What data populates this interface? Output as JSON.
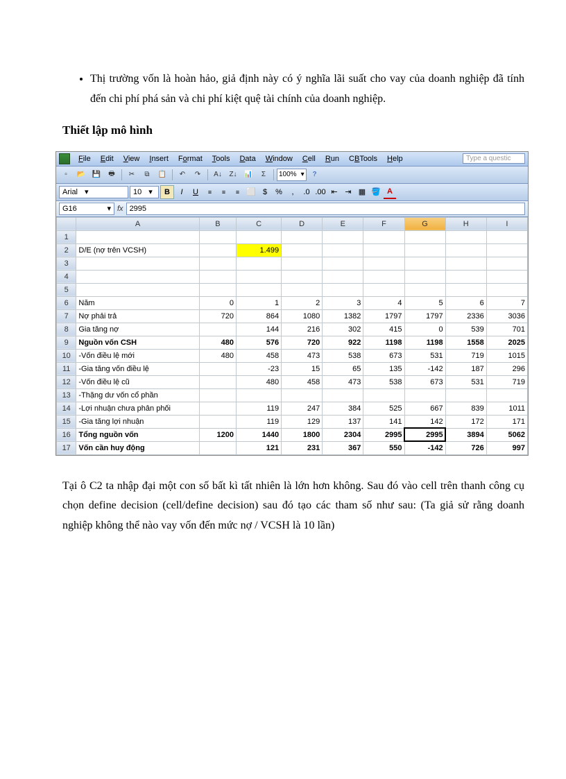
{
  "doc": {
    "bullet1": "Thị trường vốn là hoàn hảo, giả định này có ý nghĩa lãi suất cho vay của doanh nghiệp đã tính đến chi phí phá sản và chi phí kiệt quệ tài chính của doanh nghiệp.",
    "heading": "Thiết lập mô hình",
    "para2": "Tại ô C2 ta nhập đại một con số bất kì tất nhiên là lớn hơn không. Sau đó vào cell trên thanh công cụ chọn define decision (cell/define decision) sau đó tạo các tham số như sau: (Ta giả sử rằng doanh nghiệp không thể nào vay vốn đến mức nợ / VCSH là 10 lần)"
  },
  "excel": {
    "menu": [
      "File",
      "Edit",
      "View",
      "Insert",
      "Format",
      "Tools",
      "Data",
      "Window",
      "Cell",
      "Run",
      "CBTools",
      "Help"
    ],
    "qbox": "Type a questic",
    "zoom": "100%",
    "font": "Arial",
    "fontsize": "10",
    "namebox": "G16",
    "formula": "2995",
    "cols": [
      "A",
      "B",
      "C",
      "D",
      "E",
      "F",
      "G",
      "H",
      "I"
    ],
    "highlight_cell": "1.499",
    "rows": [
      {
        "n": "1",
        "label": "",
        "cells": [
          "",
          "",
          "",
          "",
          "",
          "",
          "",
          ""
        ]
      },
      {
        "n": "2",
        "label": "D/E (nợ trên VCSH)",
        "cells": [
          "",
          "__HL__",
          "",
          "",
          "",
          "",
          "",
          ""
        ]
      },
      {
        "n": "3",
        "label": "",
        "cells": [
          "",
          "",
          "",
          "",
          "",
          "",
          "",
          ""
        ]
      },
      {
        "n": "4",
        "label": "",
        "cells": [
          "",
          "",
          "",
          "",
          "",
          "",
          "",
          ""
        ]
      },
      {
        "n": "5",
        "label": "",
        "cells": [
          "",
          "",
          "",
          "",
          "",
          "",
          "",
          ""
        ]
      },
      {
        "n": "6",
        "label": "Năm",
        "cells": [
          "0",
          "1",
          "2",
          "3",
          "4",
          "5",
          "6",
          "7"
        ]
      },
      {
        "n": "7",
        "label": "Nợ phải trả",
        "cells": [
          "720",
          "864",
          "1080",
          "1382",
          "1797",
          "1797",
          "2336",
          "3036"
        ]
      },
      {
        "n": "8",
        "label": "Gia tăng nợ",
        "cells": [
          "",
          "144",
          "216",
          "302",
          "415",
          "0",
          "539",
          "701"
        ]
      },
      {
        "n": "9",
        "label": "Nguồn vốn CSH",
        "bold": true,
        "cells": [
          "480",
          "576",
          "720",
          "922",
          "1198",
          "1198",
          "1558",
          "2025"
        ]
      },
      {
        "n": "10",
        "label": "   -Vốn điều lệ mới",
        "cells": [
          "480",
          "458",
          "473",
          "538",
          "673",
          "531",
          "719",
          "1015"
        ]
      },
      {
        "n": "11",
        "label": "   -Gia tăng vốn điều lệ",
        "cells": [
          "",
          "-23",
          "15",
          "65",
          "135",
          "-142",
          "187",
          "296"
        ]
      },
      {
        "n": "12",
        "label": "   -Vốn điều lệ cũ",
        "cells": [
          "",
          "480",
          "458",
          "473",
          "538",
          "673",
          "531",
          "719"
        ]
      },
      {
        "n": "13",
        "label": "   -Thặng dư vốn cổ phần",
        "cells": [
          "",
          "",
          "",
          "",
          "",
          "",
          "",
          ""
        ]
      },
      {
        "n": "14",
        "label": "   -Lợi nhuận chưa phân phối",
        "cells": [
          "",
          "119",
          "247",
          "384",
          "525",
          "667",
          "839",
          "1011"
        ]
      },
      {
        "n": "15",
        "label": "   -Gia tăng lợi nhuận",
        "cells": [
          "",
          "119",
          "129",
          "137",
          "141",
          "142",
          "172",
          "171"
        ]
      },
      {
        "n": "16",
        "label": "Tổng nguồn vốn",
        "bold": true,
        "cells": [
          "1200",
          "1440",
          "1800",
          "2304",
          "2995",
          "2995",
          "3894",
          "5062"
        ],
        "selcol": 5
      },
      {
        "n": "17",
        "label": "Vốn cần huy động",
        "bold": true,
        "cells": [
          "",
          "121",
          "231",
          "367",
          "550",
          "-142",
          "726",
          "997"
        ]
      }
    ]
  }
}
